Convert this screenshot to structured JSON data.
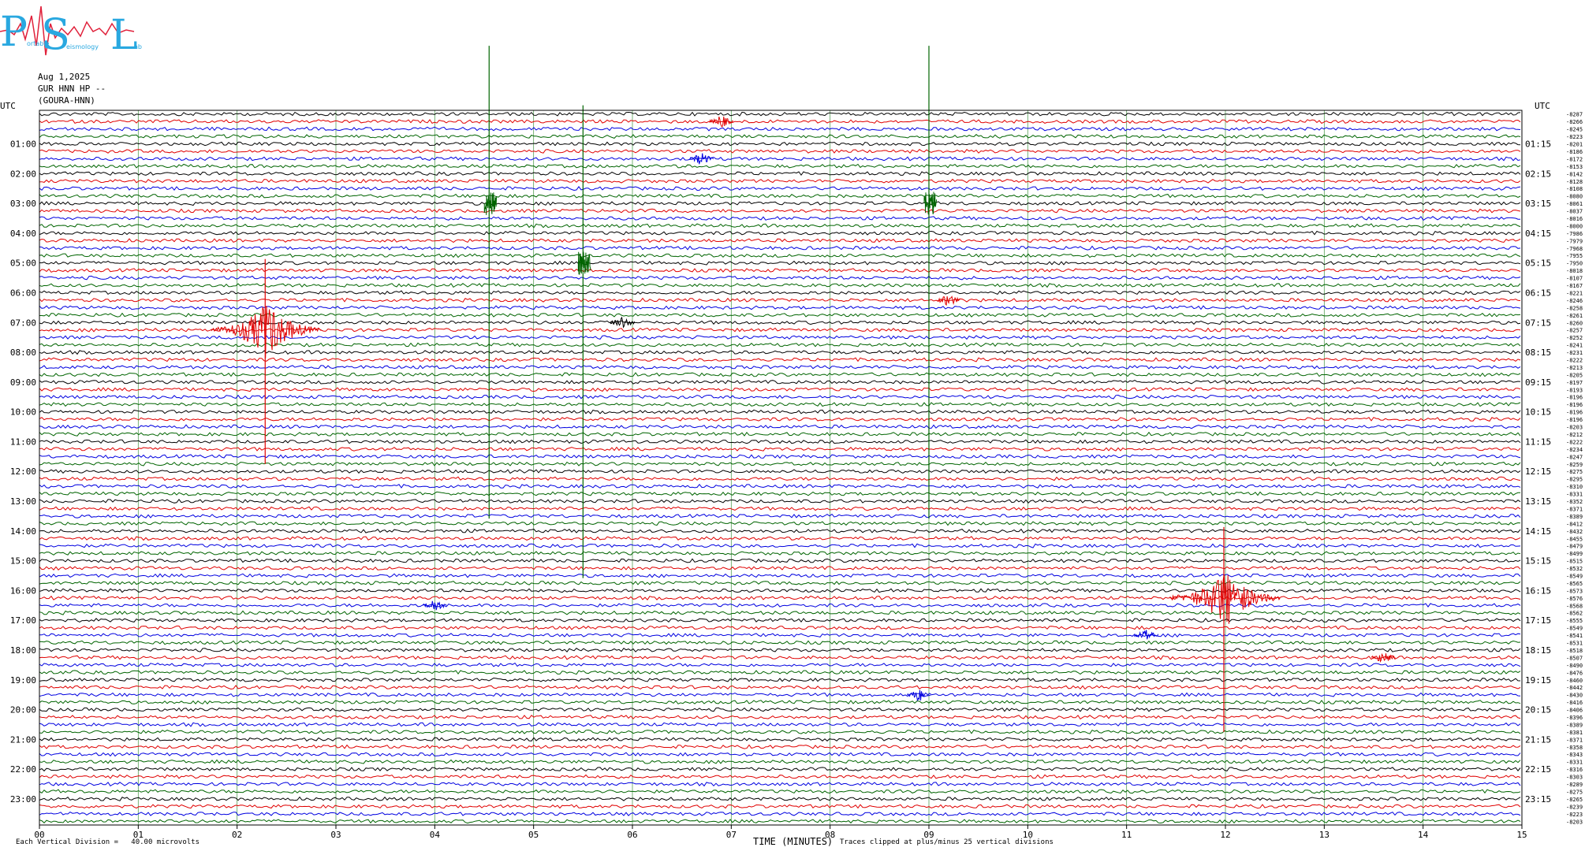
{
  "logo": {
    "letters": [
      "P",
      "S",
      "L"
    ],
    "lettering": "Portable Seismology Lab",
    "color": "#29a8e0",
    "wave_color": "#e0203a"
  },
  "header": {
    "date": "Aug 1,2025",
    "station_line": "GUR HNN HP --",
    "station_name": "(GOURA-HNN)"
  },
  "footer": {
    "left": "Each Vertical Division =   40.00 microvolts",
    "center": "TIME (MINUTES)",
    "right": "Traces clipped at plus/minus 25 vertical divisions"
  },
  "chart_data": {
    "type": "line",
    "xlabel": "TIME (MINUTES)",
    "xlim": [
      0,
      15
    ],
    "x_ticks": [
      "00",
      "01",
      "02",
      "03",
      "04",
      "05",
      "06",
      "07",
      "08",
      "09",
      "10",
      "11",
      "12",
      "13",
      "14",
      "15"
    ],
    "left_axis_title": "UTC",
    "right_axis_title": "UTC",
    "left_hour_labels": [
      "01:00",
      "02:00",
      "03:00",
      "04:00",
      "05:00",
      "06:00",
      "07:00",
      "08:00",
      "09:00",
      "10:00",
      "11:00",
      "12:00",
      "13:00",
      "14:00",
      "15:00",
      "16:00",
      "17:00",
      "18:00",
      "19:00",
      "20:00",
      "21:00",
      "22:00",
      "23:00"
    ],
    "right_hour_labels": [
      "01:15",
      "02:15",
      "03:15",
      "04:15",
      "05:15",
      "06:15",
      "07:15",
      "08:15",
      "09:15",
      "10:15",
      "11:15",
      "12:15",
      "13:15",
      "14:15",
      "15:15",
      "16:15",
      "17:15",
      "18:15",
      "19:15",
      "20:15",
      "21:15",
      "22:15",
      "23:15"
    ],
    "traces_per_hour": 4,
    "trace_minutes": 15,
    "trace_colors": [
      "#000000",
      "#e00000",
      "#0000e0",
      "#006400"
    ],
    "trace_offsets": [
      -8287,
      -8266,
      -8245,
      -8223,
      -8201,
      -8186,
      -8172,
      -8153,
      -8142,
      -8128,
      -8108,
      -8080,
      -8061,
      -8037,
      -8016,
      -8000,
      -7986,
      -7979,
      -7968,
      -7955,
      -7950,
      -8018,
      -8107,
      -8167,
      -8221,
      -8246,
      -8258,
      -8261,
      -8260,
      -8257,
      -8252,
      -8241,
      -8231,
      -8222,
      -8213,
      -8205,
      -8197,
      -8193,
      -8196,
      -8196,
      -8196,
      -8196,
      -8203,
      -8212,
      -8222,
      -8234,
      -8247,
      -8259,
      -8275,
      -8295,
      -8310,
      -8331,
      -8352,
      -8371,
      -8389,
      -8412,
      -8432,
      -8455,
      -8479,
      -8499,
      -8515,
      -8532,
      -8549,
      -8565,
      -8573,
      -8576,
      -8568,
      -8562,
      -8555,
      -8549,
      -8541,
      -8531,
      -8518,
      -8507,
      -8490,
      -8476,
      -8460,
      -8442,
      -8430,
      -8416,
      -8406,
      -8396,
      -8389,
      -8381,
      -8371,
      -8358,
      -8343,
      -8331,
      -8316,
      -8303,
      -8289,
      -8275,
      -8265,
      -8239,
      -8223,
      -8203
    ],
    "events": [
      {
        "minute": 4.55,
        "row": 12,
        "color": "#006400",
        "type": "spike"
      },
      {
        "minute": 5.5,
        "row": 20,
        "color": "#006400",
        "type": "spike"
      },
      {
        "minute": 9.0,
        "row": 12,
        "color": "#006400",
        "type": "spike"
      },
      {
        "minute": 2.3,
        "row": 29,
        "color": "#e00000",
        "type": "quake"
      },
      {
        "minute": 6.9,
        "row": 1,
        "color": "#e00000",
        "type": "burst"
      },
      {
        "minute": 6.7,
        "row": 6,
        "color": "#0000e0",
        "type": "burst"
      },
      {
        "minute": 5.9,
        "row": 28,
        "color": "#000000",
        "type": "burst"
      },
      {
        "minute": 12.0,
        "row": 65,
        "color": "#e00000",
        "type": "quake"
      },
      {
        "minute": 11.2,
        "row": 70,
        "color": "#0000e0",
        "type": "burst"
      },
      {
        "minute": 4.0,
        "row": 66,
        "color": "#0000e0",
        "type": "burst"
      },
      {
        "minute": 8.9,
        "row": 78,
        "color": "#0000e0",
        "type": "burst"
      },
      {
        "minute": 9.2,
        "row": 25,
        "color": "#e00000",
        "type": "burst"
      },
      {
        "minute": 13.6,
        "row": 73,
        "color": "#e00000",
        "type": "burst"
      }
    ]
  }
}
